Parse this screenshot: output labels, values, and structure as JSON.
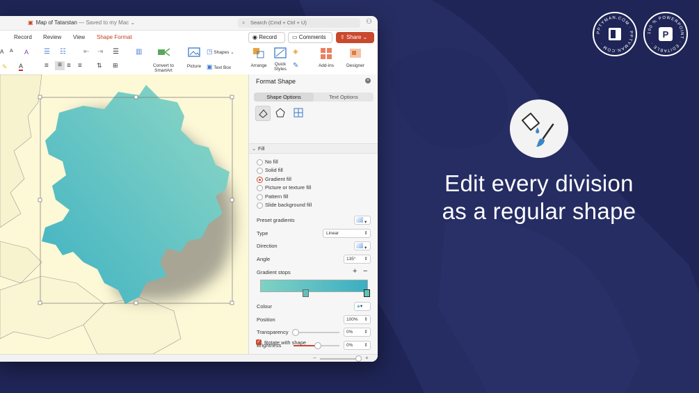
{
  "window": {
    "doc_title": "Map of Tatarstan",
    "saved_state": "— Saved to my Mac",
    "search_placeholder": "Search (Cmd + Ctrl + U)"
  },
  "tabs": [
    "Record",
    "Review",
    "View",
    "Shape Format"
  ],
  "actions": {
    "record": "Record",
    "comments": "Comments",
    "share": "Share"
  },
  "ribbon": {
    "convert_smartart": [
      "Convert to",
      "SmartArt"
    ],
    "picture": "Picture",
    "shapes": "Shapes",
    "textbox": "Text Box",
    "arrange": "Arrange",
    "quick_styles": [
      "Quick",
      "Styles"
    ],
    "addins": "Add-ins",
    "designer": "Designer"
  },
  "pane": {
    "title": "Format Shape",
    "seg_shape": "Shape Options",
    "seg_text": "Text Options",
    "section": "Fill",
    "fill_options": [
      "No fill",
      "Solid fill",
      "Gradient fill",
      "Picture or texture fill",
      "Pattern fill",
      "Slide background fill"
    ],
    "selected_fill_index": 2,
    "preset_gradients": "Preset gradients",
    "type_label": "Type",
    "type_value": "Linear",
    "direction_label": "Direction",
    "angle_label": "Angle",
    "angle_value": "135°",
    "gradient_stops": "Gradient stops",
    "colour_label": "Colour",
    "position_label": "Position",
    "position_value": "100%",
    "transparency_label": "Transparency",
    "transparency_value": "0%",
    "brightness_label": "Brightness",
    "brightness_value": "0%",
    "rotate_label": "Rotate with shape",
    "rotate_checked": true
  },
  "promo": {
    "headline_line1": "Edit every division",
    "headline_line2": "as a regular shape",
    "badge1_text": "PPTYMAN.COM · PPTYMAN.COM ·",
    "badge2_text": "100 % POWERPOINT · EDITABLE ·"
  },
  "colors": {
    "accent": "#c9492e",
    "shape_fill_start": "#7fd2c3",
    "shape_fill_end": "#3aaec2",
    "background": "#1f2556"
  }
}
